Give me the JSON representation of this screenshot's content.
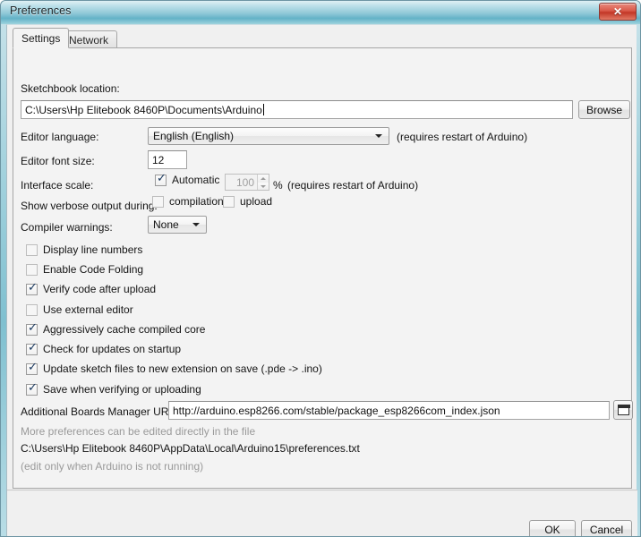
{
  "window": {
    "title": "Preferences",
    "close_label": "✕",
    "accent_titlebar": "#8ec7d6",
    "panel_bg": "#f3f3f3"
  },
  "tabs": [
    {
      "label": "Settings",
      "active": true
    },
    {
      "label": "Network",
      "active": false
    }
  ],
  "settings": {
    "sketchbook": {
      "label": "Sketchbook location:",
      "value": "C:\\Users\\Hp Elitebook 8460P\\Documents\\Arduino",
      "browse_label": "Browse"
    },
    "editor_language": {
      "label": "Editor language:",
      "value": "English (English)",
      "note": "(requires restart of Arduino)"
    },
    "editor_font_size": {
      "label": "Editor font size:",
      "value": "12"
    },
    "interface_scale": {
      "label": "Interface scale:",
      "automatic_label": "Automatic",
      "automatic_checked": true,
      "scale_value": "100",
      "percent_label": "%",
      "note": "(requires restart of Arduino)"
    },
    "verbose_output": {
      "label": "Show verbose output during:",
      "compilation_label": "compilation",
      "compilation_checked": false,
      "upload_label": "upload",
      "upload_checked": false
    },
    "compiler_warnings": {
      "label": "Compiler warnings:",
      "value": "None"
    },
    "checkboxes": [
      {
        "label": "Display line numbers",
        "checked": false
      },
      {
        "label": "Enable Code Folding",
        "checked": false
      },
      {
        "label": "Verify code after upload",
        "checked": true
      },
      {
        "label": "Use external editor",
        "checked": false
      },
      {
        "label": "Aggressively cache compiled core",
        "checked": true
      },
      {
        "label": "Check for updates on startup",
        "checked": true
      },
      {
        "label": "Update sketch files to new extension on save (.pde -> .ino)",
        "checked": true
      },
      {
        "label": "Save when verifying or uploading",
        "checked": true
      }
    ],
    "boards_manager_urls": {
      "label": "Additional Boards Manager URLs:",
      "value": "http://arduino.esp8266.com/stable/package_esp8266com_index.json"
    },
    "prefs_file": {
      "hint": "More preferences can be edited directly in the file",
      "path": "C:\\Users\\Hp Elitebook 8460P\\AppData\\Local\\Arduino15\\preferences.txt",
      "note": "(edit only when Arduino is not running)"
    }
  },
  "footer": {
    "ok_label": "OK",
    "cancel_label": "Cancel"
  }
}
